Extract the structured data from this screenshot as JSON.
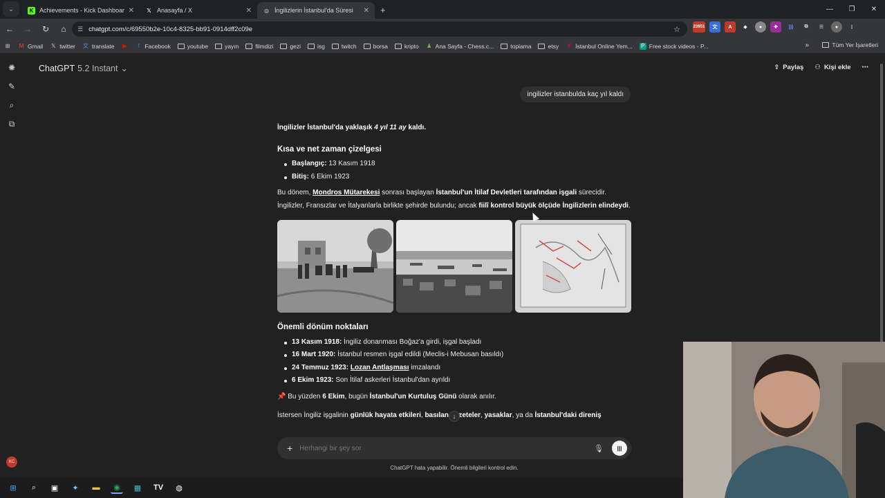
{
  "browser": {
    "tabs": [
      {
        "title": "Achievements - Kick Dashboard",
        "icon": "kick-icon",
        "active": false
      },
      {
        "title": "Anasayfa / X",
        "icon": "x-icon",
        "active": false
      },
      {
        "title": "İngilizlerin İstanbul'da Süresi",
        "icon": "chatgpt-icon",
        "active": true
      }
    ],
    "url": "chatgpt.com/c/69550b2e-10c4-8325-bb91-0914dff2c09e",
    "extension_badge": "23951",
    "bookmarks": [
      "Gmail",
      "twitter",
      "translate",
      "",
      "Facebook",
      "youtube",
      "yayın",
      "filmdizi",
      "gezi",
      "isg",
      "twitch",
      "borsa",
      "kripto",
      "Ana Sayfa - Chess.c...",
      "toplama",
      "etsy",
      "İstanbul Online Yem...",
      "Free stock videos - P..."
    ],
    "bookmarks_all": "Tüm Yer İşaretleri"
  },
  "app": {
    "model_name": "ChatGPT",
    "model_version": "5.2 Instant",
    "share_label": "Paylaş",
    "add_person_label": "Kişi ekle",
    "avatar_initials": "KC"
  },
  "chat": {
    "user_message": "ingilizler istanbulda kaç yıl kaldı",
    "answer": {
      "intro_pre": "İngilizler İstanbul'da yaklaşık ",
      "intro_em": "4 yıl 11 ay",
      "intro_post": " kaldı.",
      "timeline_heading": "Kısa ve net zaman çizelgesi",
      "timeline": [
        {
          "label": "Başlangıç:",
          "value": " 13 Kasım 1918"
        },
        {
          "label": "Bitiş:",
          "value": " 6 Ekim 1923"
        }
      ],
      "para1_a": "Bu dönem, ",
      "para1_link": "Mondros Mütarekesi",
      "para1_b": " sonrası başlayan ",
      "para1_bold": "İstanbul'un İtilaf Devletleri tarafından işgali",
      "para1_c": " sürecidir.",
      "para2_a": "İngilizler, Fransızlar ve İtalyanlarla birlikte şehirde bulundu; ancak ",
      "para2_bold": "fiilî kontrol büyük ölçüde İngilizlerin elindeydi",
      "para2_c": ".",
      "turning_heading": "Önemli dönüm noktaları",
      "turning": [
        {
          "label": "13 Kasım 1918:",
          "value": " İngiliz donanması Boğaz'a girdi, işgal başladı"
        },
        {
          "label": "16 Mart 1920:",
          "value": " İstanbul resmen işgal edildi (Meclis-i Mebusan basıldı)"
        },
        {
          "label": "24 Temmuz 1923:",
          "link": "Lozan Antlaşması",
          "value": " imzalandı"
        },
        {
          "label": "6 Ekim 1923:",
          "value": " Son İtilaf askerleri İstanbul'dan ayrıldı"
        }
      ],
      "note_a": " Bu yüzden ",
      "note_bold1": "6 Ekim",
      "note_b": ", bugün ",
      "note_bold2": "İstanbul'un Kurtuluş Günü",
      "note_c": " olarak anılır.",
      "more_a": "İstersen İngiliz işgalinin ",
      "more_b1": "günlük hayata etkileri",
      "more_sep1": ", ",
      "more_b2": "basılan gazeteler",
      "more_sep2": ", ",
      "more_b3": "yasaklar",
      "more_sep3": ", ya da ",
      "more_b4": "İstanbul'daki direniş"
    }
  },
  "composer": {
    "placeholder": "Herhangi bir şey sor",
    "disclaimer": "ChatGPT hata yapabilir. Önemli bilgileri kontrol edin."
  }
}
